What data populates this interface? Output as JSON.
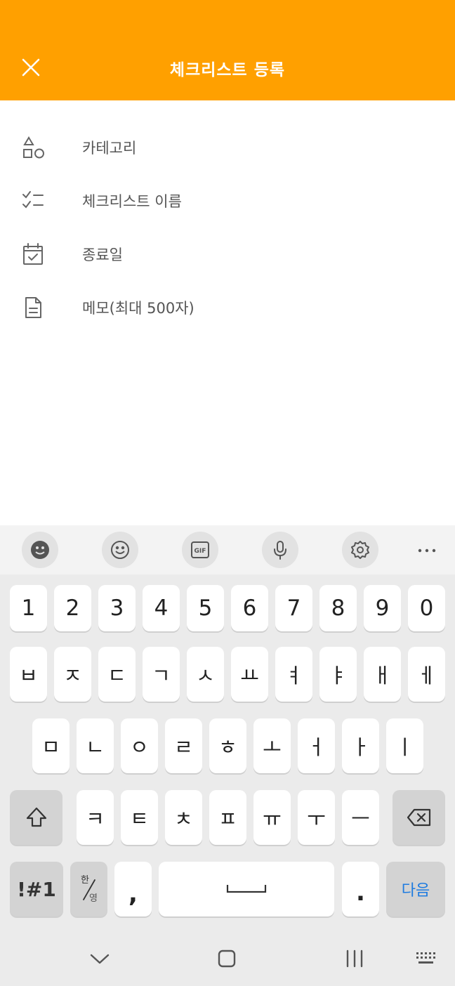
{
  "app": {
    "title": "체크리스트 등록",
    "accent_color": "#FFA000",
    "close_icon": "close-icon"
  },
  "form": {
    "fields": [
      {
        "label": "카테고리",
        "icon": "category-shapes-icon"
      },
      {
        "label": "체크리스트 이름",
        "icon": "checklist-icon"
      },
      {
        "label": "종료일",
        "icon": "calendar-check-icon"
      },
      {
        "label": "메모(최대 500자)",
        "icon": "document-icon"
      }
    ]
  },
  "keyboard": {
    "toolbar": [
      "sticker-icon",
      "emoji-icon",
      "gif-icon",
      "microphone-icon",
      "settings-icon",
      "more-icon"
    ],
    "row_numbers": [
      "1",
      "2",
      "3",
      "4",
      "5",
      "6",
      "7",
      "8",
      "9",
      "0"
    ],
    "row1": [
      "ㅂ",
      "ㅈ",
      "ㄷ",
      "ㄱ",
      "ㅅ",
      "ㅛ",
      "ㅕ",
      "ㅑ",
      "ㅐ",
      "ㅔ"
    ],
    "row2": [
      "ㅁ",
      "ㄴ",
      "ㅇ",
      "ㄹ",
      "ㅎ",
      "ㅗ",
      "ㅓ",
      "ㅏ",
      "ㅣ"
    ],
    "row3": [
      "ㅋ",
      "ㅌ",
      "ㅊ",
      "ㅍ",
      "ㅠ",
      "ㅜ",
      "ㅡ"
    ],
    "symbols_key": "!#1",
    "lang_top": "한",
    "lang_bottom": "영",
    "comma": ",",
    "period": ".",
    "next_key": "다음",
    "next_color": "#1E7BE0"
  },
  "navbar": [
    "back-chevron-icon",
    "home-icon",
    "recents-icon",
    "keyboard-switch-icon"
  ]
}
